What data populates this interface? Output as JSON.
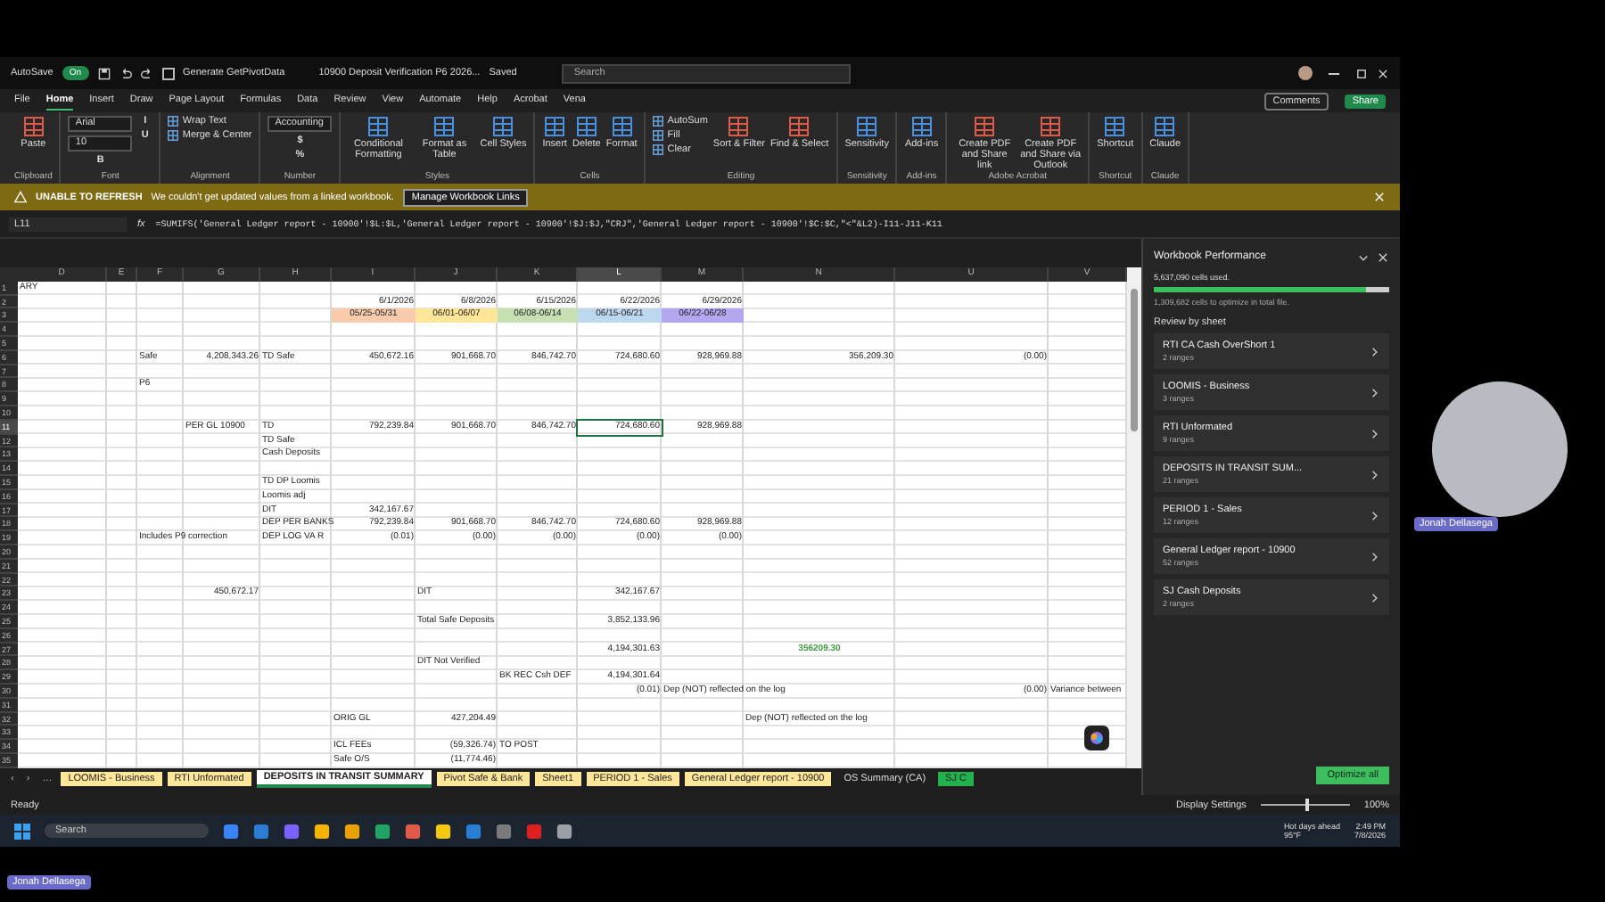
{
  "title_bar": {
    "autosave_label": "AutoSave",
    "autosave_on": true,
    "autosave_state": "On",
    "pivot_checkbox": {
      "label": "Generate GetPivotData",
      "checked": false
    },
    "file_name": "10900 Deposit Verification P6 2026...",
    "save_status": "Saved",
    "search": {
      "placeholder": "Search"
    }
  },
  "menu": {
    "tabs": [
      {
        "label": "File",
        "selected": false
      },
      {
        "label": "Home",
        "selected": true
      },
      {
        "label": "Insert",
        "selected": false
      },
      {
        "label": "Draw",
        "selected": false
      },
      {
        "label": "Page Layout",
        "selected": false
      },
      {
        "label": "Formulas",
        "selected": false
      },
      {
        "label": "Data",
        "selected": false
      },
      {
        "label": "Review",
        "selected": false
      },
      {
        "label": "View",
        "selected": false
      },
      {
        "label": "Automate",
        "selected": false
      },
      {
        "label": "Help",
        "selected": false
      },
      {
        "label": "Acrobat",
        "selected": false
      },
      {
        "label": "Vena",
        "selected": false
      }
    ],
    "comments": "Comments",
    "share": "Share"
  },
  "ribbon": {
    "groups": [
      {
        "name": "Clipboard",
        "buttons": [
          {
            "label": "Paste",
            "kind": "large"
          }
        ]
      },
      {
        "name": "Font",
        "buttons": [
          {
            "label": "Arial",
            "kind": "field"
          },
          {
            "label": "10",
            "kind": "field"
          },
          {
            "label": "B",
            "kind": "glyph"
          },
          {
            "label": "I",
            "kind": "glyph"
          },
          {
            "label": "U",
            "kind": "glyph"
          }
        ]
      },
      {
        "name": "Alignment",
        "buttons": [
          {
            "label": "Wrap Text",
            "kind": "small"
          },
          {
            "label": "Merge & Center",
            "kind": "small"
          }
        ]
      },
      {
        "name": "Number",
        "buttons": [
          {
            "label": "Accounting",
            "kind": "field"
          },
          {
            "label": "$",
            "kind": "glyph"
          },
          {
            "label": "%",
            "kind": "glyph"
          }
        ]
      },
      {
        "name": "Styles",
        "buttons": [
          {
            "label": "Conditional Formatting",
            "kind": "large"
          },
          {
            "label": "Format as Table",
            "kind": "large"
          },
          {
            "label": "Cell Styles",
            "kind": "large"
          }
        ]
      },
      {
        "name": "Cells",
        "buttons": [
          {
            "label": "Insert",
            "kind": "large"
          },
          {
            "label": "Delete",
            "kind": "large"
          },
          {
            "label": "Format",
            "kind": "large"
          }
        ]
      },
      {
        "name": "Editing",
        "buttons": [
          {
            "label": "AutoSum",
            "kind": "small"
          },
          {
            "label": "Fill",
            "kind": "small"
          },
          {
            "label": "Clear",
            "kind": "small"
          },
          {
            "label": "Sort & Filter",
            "kind": "large"
          },
          {
            "label": "Find & Select",
            "kind": "large"
          }
        ]
      },
      {
        "name": "Sensitivity",
        "buttons": [
          {
            "label": "Sensitivity",
            "kind": "large"
          }
        ]
      },
      {
        "name": "Add-ins",
        "buttons": [
          {
            "label": "Add-ins",
            "kind": "large"
          }
        ]
      },
      {
        "name": "Adobe Acrobat",
        "buttons": [
          {
            "label": "Create PDF and Share link",
            "kind": "large"
          },
          {
            "label": "Create PDF and Share via Outlook",
            "kind": "large"
          }
        ]
      },
      {
        "name": "Shortcut",
        "buttons": [
          {
            "label": "Shortcut",
            "kind": "large"
          }
        ]
      },
      {
        "name": "Claude",
        "buttons": [
          {
            "label": "Claude",
            "kind": "large"
          }
        ]
      }
    ]
  },
  "warning": {
    "title": "UNABLE TO REFRESH",
    "message": "We couldn't get updated values from a linked workbook.",
    "button": "Manage Workbook Links"
  },
  "formula_bar": {
    "name_box": "L11",
    "fx": "fx",
    "formula": "=SUMIFS('General Ledger report - 10900'!$L:$L,'General Ledger report - 10900'!$J:$J,\"CRJ\",'General Ledger report - 10900'!$C:$C,\"<\"&L2)-I11-J11-K11"
  },
  "sheet": {
    "columns": [
      "D",
      "E",
      "F",
      "G",
      "H",
      "I",
      "J",
      "K",
      "L",
      "M",
      "N",
      "U",
      "V"
    ],
    "rows": [
      {
        "number": "1",
        "cells": {
          "D": "ARY"
        }
      },
      {
        "number": "2",
        "cells": {
          "I": "6/1/2026",
          "J": "6/8/2026",
          "K": "6/15/2026",
          "L": "6/22/2026",
          "M": "6/29/2026"
        }
      },
      {
        "number": "3",
        "cells": {
          "I": {
            "text": "05/25-05/31",
            "kind": "fill",
            "color": "#f8cbad"
          },
          "J": {
            "text": "06/01-06/07",
            "kind": "fill",
            "color": "#ffe699"
          },
          "K": {
            "text": "06/08-06/14",
            "kind": "fill",
            "color": "#c6e0b4"
          },
          "L": {
            "text": "06/15-06/21",
            "kind": "fill",
            "color": "#bdd7ee"
          },
          "M": {
            "text": "06/22-06/28",
            "kind": "fill",
            "color": "#b4a7f0"
          }
        }
      },
      {
        "number": "4",
        "cells": {}
      },
      {
        "number": "5",
        "cells": {}
      },
      {
        "number": "6",
        "cells": {
          "F": "Safe",
          "G": "4,208,343.26",
          "H": "TD Safe",
          "I": "450,672.16",
          "J": "901,668.70",
          "K": "846,742.70",
          "L": "724,680.60",
          "M": "928,969.88",
          "N": "356,209.30",
          "U": "(0.00)"
        }
      },
      {
        "number": "7",
        "cells": {}
      },
      {
        "number": "8",
        "cells": {
          "F": "P6"
        }
      },
      {
        "number": "9",
        "cells": {}
      },
      {
        "number": "10",
        "cells": {}
      },
      {
        "number": "11",
        "cells": {
          "G": "PER GL 10900",
          "H": "TD",
          "I": "792,239.84",
          "J": "901,668.70",
          "K": "846,742.70",
          "L": {
            "text": "724,680.60",
            "kind": "plain",
            "selected": true
          },
          "M": "928,969.88"
        }
      },
      {
        "number": "12",
        "cells": {
          "H": "TD Safe"
        }
      },
      {
        "number": "13",
        "cells": {
          "H": "Cash Deposits"
        }
      },
      {
        "number": "14",
        "cells": {}
      },
      {
        "number": "15",
        "cells": {
          "H": "TD DP Loomis"
        }
      },
      {
        "number": "16",
        "cells": {
          "H": "Loomis adj"
        }
      },
      {
        "number": "17",
        "cells": {
          "H": "DIT",
          "I": "342,167.67"
        }
      },
      {
        "number": "18",
        "cells": {
          "H": "DEP PER BANKS",
          "I": "792,239.84",
          "J": "901,668.70",
          "K": "846,742.70",
          "L": "724,680.60",
          "M": "928,969.88"
        }
      },
      {
        "number": "19",
        "cells": {
          "F": "Includes P9 correction",
          "H": "DEP LOG VA R",
          "I": "(0.01)",
          "J": "(0.00)",
          "K": "(0.00)",
          "L": "(0.00)",
          "M": "(0.00)"
        }
      },
      {
        "number": "20",
        "cells": {}
      },
      {
        "number": "21",
        "cells": {}
      },
      {
        "number": "22",
        "cells": {}
      },
      {
        "number": "23",
        "cells": {
          "G": "450,672.17",
          "J": "DIT",
          "L": "342,167.67"
        }
      },
      {
        "number": "24",
        "cells": {}
      },
      {
        "number": "25",
        "cells": {
          "J": "Total Safe Deposits",
          "L": "3,852,133.96"
        }
      },
      {
        "number": "26",
        "cells": {}
      },
      {
        "number": "27",
        "cells": {
          "L": "4,194,301.63",
          "N": {
            "text": "356209.30",
            "kind": "emphasis",
            "color": "#3c9a3c"
          }
        }
      },
      {
        "number": "28",
        "cells": {
          "J": "DIT Not Verified"
        }
      },
      {
        "number": "29",
        "cells": {
          "K": "BK REC Csh DEF",
          "L": "4,194,301.64"
        }
      },
      {
        "number": "30",
        "cells": {
          "L": "(0.01)",
          "M": "Dep (NOT) reflected on the log",
          "U": "(0.00)",
          "V": "Variance between"
        }
      },
      {
        "number": "31",
        "cells": {}
      },
      {
        "number": "32",
        "cells": {
          "I": "ORIG GL",
          "J": "427,204.49",
          "N": "Dep (NOT) reflected on the log"
        }
      },
      {
        "number": "33",
        "cells": {}
      },
      {
        "number": "34",
        "cells": {
          "I": "ICL FEEs",
          "J": "(59,326.74)",
          "K": "TO POST"
        }
      },
      {
        "number": "35",
        "cells": {
          "I": "Safe O/S",
          "J": "(11,774.46)"
        }
      }
    ],
    "tab_nav": [
      "‹",
      "›",
      "…"
    ],
    "tabs": [
      {
        "label": "LOOMIS - Business",
        "selected": false,
        "color": "#ffe699"
      },
      {
        "label": "RTI Unformated",
        "selected": false,
        "color": "#ffe699"
      },
      {
        "label": "DEPOSITS IN TRANSIT SUMMARY",
        "selected": true,
        "color": "#ffffff"
      },
      {
        "label": "Pivot Safe & Bank",
        "selected": false,
        "color": "#ffe699"
      },
      {
        "label": "Sheet1",
        "selected": false,
        "color": "#ffe699"
      },
      {
        "label": "PERIOD 1 - Sales",
        "selected": false,
        "color": "#ffe699"
      },
      {
        "label": "General Ledger report - 10900",
        "selected": false,
        "color": "#ffe699"
      },
      {
        "label": "OS Summary (CA)",
        "selected": false,
        "color": "#1f1f1f"
      },
      {
        "label": "SJ C",
        "selected": false,
        "color": "#22b14c"
      }
    ]
  },
  "performance_pane": {
    "title": "Workbook Performance",
    "cells_used": "5,637,090 cells used.",
    "level": 0.9,
    "optimize_note": "1,309,682 cells to optimize in total file.",
    "review_heading": "Review by sheet",
    "sheets": [
      {
        "name": "RTI CA Cash OverShort 1",
        "ranges": "2 ranges"
      },
      {
        "name": "LOOMIS - Business",
        "ranges": "3 ranges"
      },
      {
        "name": "RTI Unformated",
        "ranges": "9 ranges"
      },
      {
        "name": "DEPOSITS IN TRANSIT SUM...",
        "ranges": "21 ranges"
      },
      {
        "name": "PERIOD 1 - Sales",
        "ranges": "12 ranges"
      },
      {
        "name": "General Ledger report - 10900",
        "ranges": "52 ranges"
      },
      {
        "name": "SJ Cash Deposits",
        "ranges": "2 ranges"
      }
    ],
    "button": "Optimize all"
  },
  "status_bar": {
    "status": "Ready",
    "display_settings": "Display Settings",
    "zoom": "100%",
    "level": 0.5
  },
  "taskbar": {
    "search": {
      "placeholder": "Search"
    },
    "weather": "Hot days ahead",
    "temperature": "95°F",
    "time": "2:49 PM",
    "date": "7/8/2026"
  },
  "participant": {
    "name": "Jonah Dellasega"
  },
  "self_view": {
    "name": "Jonah Dellasega"
  }
}
